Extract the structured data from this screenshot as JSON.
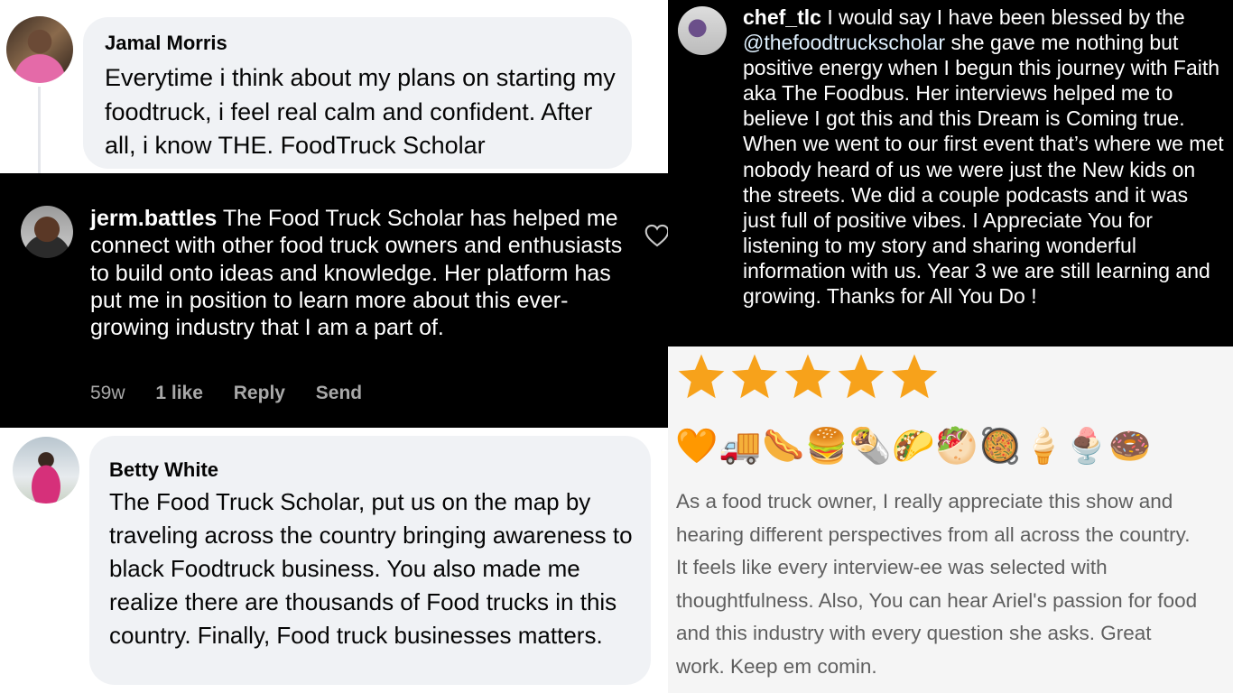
{
  "comment1": {
    "name": "Jamal Morris",
    "text": "Everytime i think about my plans on starting my foodtruck, i feel real calm and confident. After all, i know THE. FoodTruck Scholar"
  },
  "comment2": {
    "username": "jerm.battles",
    "text": "The Food Truck Scholar has helped me connect with other food truck owners and enthusiasts to build onto ideas and knowledge. Her platform has put me in position to learn more about this ever-growing industry that I am a part of.",
    "time": "59w",
    "likes": "1 like",
    "reply": "Reply",
    "send": "Send",
    "icon": "heart-icon"
  },
  "comment3": {
    "name": "Betty White",
    "text": "The Food Truck Scholar, put us on the map by traveling across the country bringing awareness to black Foodtruck business. You also made me realize there are  thousands of Food trucks in this country. Finally, Food truck businesses matters."
  },
  "comment4": {
    "username": "chef_tlc",
    "text_before": "I would say I have been blessed by the",
    "mention": "@thefoodtruckscholar",
    "text_after": "she gave me nothing but positive energy when I begun this journey with Faith aka The Foodbus. Her interviews helped me to believe I got this and this Dream is Coming true. When we went to our first event that’s where we met nobody heard of us we were just the New kids on the streets. We did a couple podcasts and it was just full of positive vibes. I Appreciate You for listening to my story and sharing wonderful information with us. Year 3 we are still learning and growing. Thanks for All You Do !"
  },
  "review": {
    "rating": 5,
    "emojis": [
      "🧡",
      "🚚",
      "🌭",
      "🍔",
      "🌯",
      "🌮",
      "🥙",
      "🥘",
      "🍦",
      "🍨",
      "🍩"
    ],
    "text": "As a food truck owner, I really appreciate this show and hearing different perspectives from all across the country. It feels like every interview-ee was selected with thoughtfulness. Also, You can hear Ariel's passion for food and this industry with every question she asks. Great work. Keep em comin."
  },
  "colors": {
    "fb_bubble": "#f0f2f5",
    "ig_background": "#000000",
    "ig_meta": "#a8a8a8",
    "star": "#f7a21b"
  }
}
